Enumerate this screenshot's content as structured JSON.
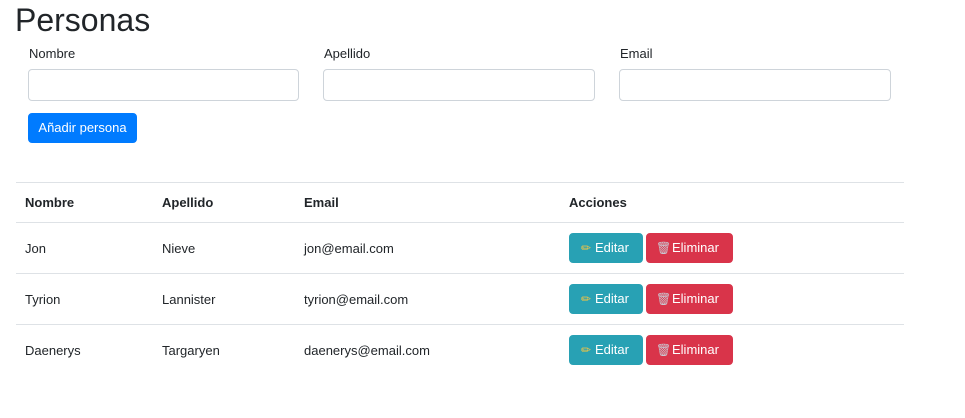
{
  "page": {
    "title": "Personas"
  },
  "form": {
    "nombre_label": "Nombre",
    "nombre_value": "",
    "apellido_label": "Apellido",
    "apellido_value": "",
    "email_label": "Email",
    "email_value": "",
    "add_button": "Añadir persona"
  },
  "table": {
    "headers": {
      "nombre": "Nombre",
      "apellido": "Apellido",
      "email": "Email",
      "acciones": "Acciones"
    },
    "rows": [
      {
        "nombre": "Jon",
        "apellido": "Nieve",
        "email": "jon@email.com"
      },
      {
        "nombre": "Tyrion",
        "apellido": "Lannister",
        "email": "tyrion@email.com"
      },
      {
        "nombre": "Daenerys",
        "apellido": "Targaryen",
        "email": "daenerys@email.com"
      }
    ],
    "edit_label": "Editar",
    "delete_label": "Eliminar",
    "edit_icon": "pencil-icon",
    "delete_icon": "trash-icon"
  },
  "colors": {
    "primary": "#007bff",
    "info": "#28a1b4",
    "danger": "#d9344a",
    "border": "#dee2e6"
  }
}
